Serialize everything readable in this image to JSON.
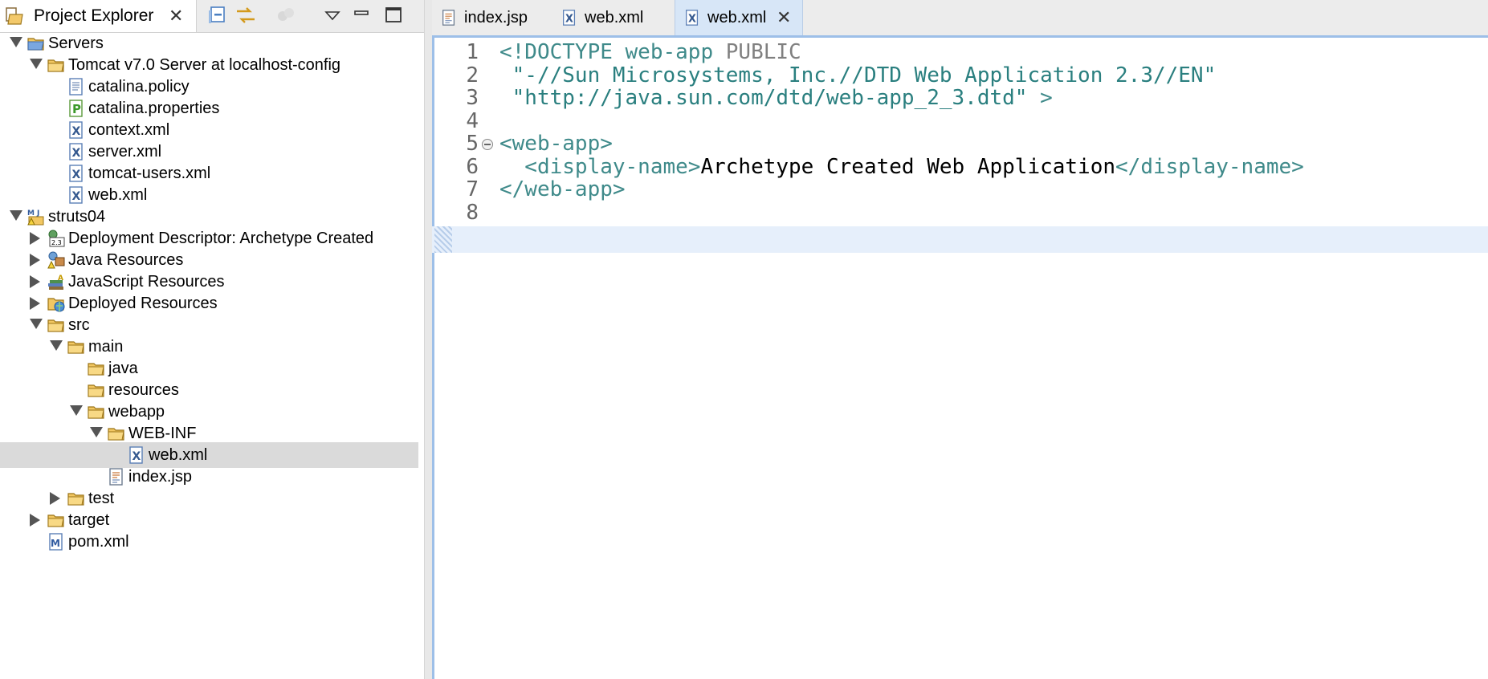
{
  "explorer": {
    "title": "Project Explorer",
    "close_glyph": "✕",
    "toolbar": {
      "collapse_all_icon": "collapse-all-icon",
      "link_editor_icon": "link-with-editor-icon",
      "filter_icon": "filter-icon",
      "view_menu_icon": "view-menu-icon",
      "minimize_icon": "minimize-icon",
      "maximize_icon": "maximize-icon"
    },
    "tree": [
      {
        "label": "Servers",
        "depth": 0,
        "twisty": "open",
        "icon": "servers-folder-icon"
      },
      {
        "label": "Tomcat v7.0 Server at localhost-config",
        "depth": 1,
        "twisty": "open",
        "icon": "folder-icon"
      },
      {
        "label": "catalina.policy",
        "depth": 2,
        "twisty": "none",
        "icon": "text-file-icon"
      },
      {
        "label": "catalina.properties",
        "depth": 2,
        "twisty": "none",
        "icon": "properties-file-icon"
      },
      {
        "label": "context.xml",
        "depth": 2,
        "twisty": "none",
        "icon": "xml-file-icon"
      },
      {
        "label": "server.xml",
        "depth": 2,
        "twisty": "none",
        "icon": "xml-file-icon"
      },
      {
        "label": "tomcat-users.xml",
        "depth": 2,
        "twisty": "none",
        "icon": "xml-file-icon"
      },
      {
        "label": "web.xml",
        "depth": 2,
        "twisty": "none",
        "icon": "xml-file-icon"
      },
      {
        "label": "struts04",
        "depth": 0,
        "twisty": "open",
        "icon": "maven-project-icon"
      },
      {
        "label": "Deployment Descriptor: Archetype Created",
        "depth": 1,
        "twisty": "closed",
        "icon": "deployment-descriptor-icon"
      },
      {
        "label": "Java Resources",
        "depth": 1,
        "twisty": "closed",
        "icon": "java-resources-icon"
      },
      {
        "label": "JavaScript Resources",
        "depth": 1,
        "twisty": "closed",
        "icon": "javascript-resources-icon"
      },
      {
        "label": "Deployed Resources",
        "depth": 1,
        "twisty": "closed",
        "icon": "deployed-resources-icon"
      },
      {
        "label": "src",
        "depth": 1,
        "twisty": "open",
        "icon": "folder-icon"
      },
      {
        "label": "main",
        "depth": 2,
        "twisty": "open",
        "icon": "folder-icon"
      },
      {
        "label": "java",
        "depth": 3,
        "twisty": "none",
        "icon": "folder-icon"
      },
      {
        "label": "resources",
        "depth": 3,
        "twisty": "none",
        "icon": "folder-icon"
      },
      {
        "label": "webapp",
        "depth": 3,
        "twisty": "open",
        "icon": "folder-icon"
      },
      {
        "label": "WEB-INF",
        "depth": 4,
        "twisty": "open",
        "icon": "folder-icon"
      },
      {
        "label": "web.xml",
        "depth": 5,
        "twisty": "none",
        "icon": "xml-file-icon",
        "selected": true
      },
      {
        "label": "index.jsp",
        "depth": 4,
        "twisty": "none",
        "icon": "jsp-file-icon"
      },
      {
        "label": "test",
        "depth": 2,
        "twisty": "closed",
        "icon": "folder-icon"
      },
      {
        "label": "target",
        "depth": 1,
        "twisty": "closed",
        "icon": "folder-icon"
      },
      {
        "label": "pom.xml",
        "depth": 1,
        "twisty": "none",
        "icon": "maven-pom-icon"
      }
    ]
  },
  "editor": {
    "tabs": [
      {
        "label": "index.jsp",
        "icon": "jsp-file-icon",
        "active": false
      },
      {
        "label": "web.xml",
        "icon": "xml-file-icon",
        "active": false
      },
      {
        "label": "web.xml",
        "icon": "xml-file-icon",
        "active": true
      }
    ],
    "close_glyph": "✕",
    "lines": [
      {
        "num": "1",
        "tokens": [
          {
            "t": "<!DOCTYPE web-app ",
            "c": "tag"
          },
          {
            "t": "PUBLIC",
            "c": "kw"
          }
        ]
      },
      {
        "num": "2",
        "tokens": [
          {
            "t": " \"-//Sun Microsystems, Inc.//DTD Web Application 2.3//EN\"",
            "c": "str"
          }
        ]
      },
      {
        "num": "3",
        "tokens": [
          {
            "t": " \"http://java.sun.com/dtd/web-app_2_3.dtd\"",
            "c": "str"
          },
          {
            "t": " >",
            "c": "tag"
          }
        ]
      },
      {
        "num": "4",
        "tokens": []
      },
      {
        "num": "5",
        "fold": true,
        "tokens": [
          {
            "t": "<web-app>",
            "c": "tag"
          }
        ]
      },
      {
        "num": "6",
        "tokens": [
          {
            "t": "  <display-name>",
            "c": "tag"
          },
          {
            "t": "Archetype Created Web Application",
            "c": "txt"
          },
          {
            "t": "</display-name>",
            "c": "tag"
          }
        ]
      },
      {
        "num": "7",
        "tokens": [
          {
            "t": "</web-app>",
            "c": "tag"
          }
        ]
      },
      {
        "num": "8",
        "tokens": [],
        "current": true
      }
    ]
  },
  "colors": {
    "tag": "#3f8a8a",
    "string": "#2a7f7f",
    "keyword": "#808080",
    "selection": "#dadada",
    "active_tab": "#d7e6f7",
    "current_line": "#e6effb"
  }
}
